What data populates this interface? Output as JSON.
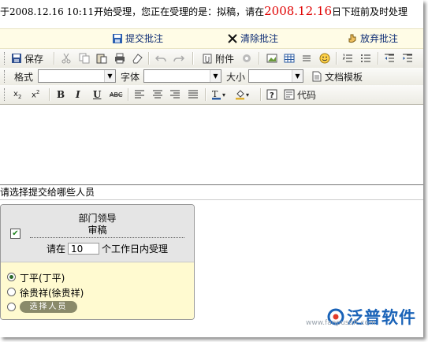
{
  "notice": {
    "prefix": "于2008.12.16 10:11开始受理，您正在受理的是：拟稿，请在",
    "deadline": "2008.12.16",
    "suffix": "日下班前及时处理"
  },
  "actions": {
    "submit": "提交批注",
    "clear": "清除批注",
    "discard": "放弃批注"
  },
  "toolbar": {
    "save": "保存",
    "attach": "附件",
    "format_label": "格式",
    "font_label": "字体",
    "size_label": "大小",
    "template": "文档模板",
    "code": "代码",
    "format_value": "",
    "font_value": "",
    "size_value": ""
  },
  "select_heading": "请选择提交给哪些人员",
  "dept": {
    "line1": "部门领导",
    "line2": "审稿",
    "days_prefix": "请在",
    "days_value": "10",
    "days_suffix": "个工作日内受理"
  },
  "people": [
    {
      "label": "丁平(丁平)",
      "checked": true
    },
    {
      "label": "徐贵祥(徐贵祥)",
      "checked": false
    }
  ],
  "select_people_button": "选择人员",
  "watermark": {
    "brand": "泛普软件",
    "url": "www.fanpusoft.com"
  },
  "colors": {
    "deadline": "#e00000",
    "action_text": "#0b2a73",
    "dept_bg": "#e5e5e5",
    "people_bg": "#fffad0",
    "brand": "#1a63b8"
  }
}
